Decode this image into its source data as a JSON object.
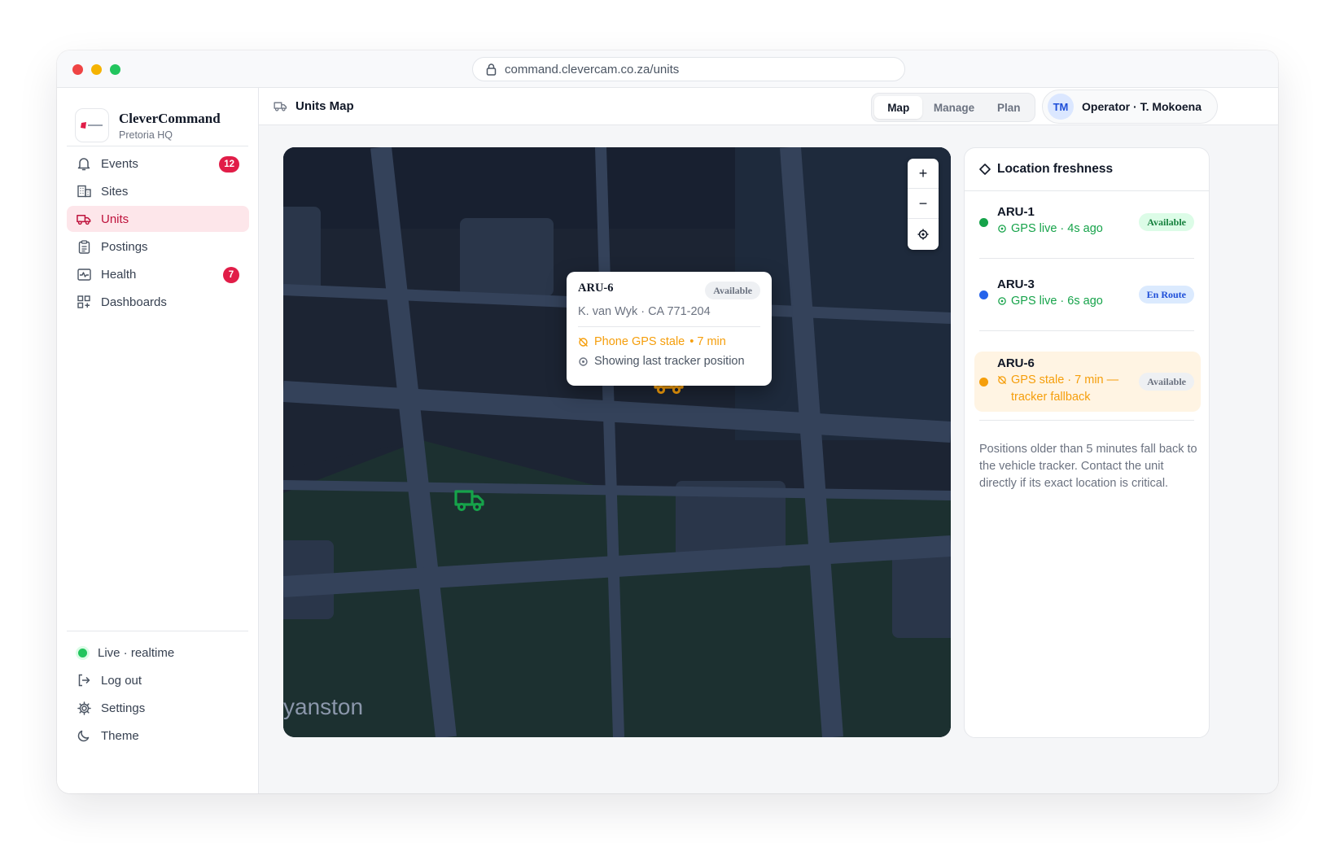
{
  "browser": {
    "url": "command.clevercam.co.za/units"
  },
  "brand": {
    "name": "CleverCommand",
    "subtitle": "Pretoria HQ"
  },
  "sidebar": {
    "items": [
      {
        "label": "Events",
        "icon": "bell-icon",
        "badge": "12"
      },
      {
        "label": "Sites",
        "icon": "building-icon"
      },
      {
        "label": "Units",
        "icon": "truck-icon",
        "active": true
      },
      {
        "label": "Postings",
        "icon": "clipboard-icon"
      },
      {
        "label": "Health",
        "icon": "pulse-icon",
        "badge": "7"
      },
      {
        "label": "Dashboards",
        "icon": "grid-icon"
      }
    ],
    "footer": [
      {
        "label": "Live · realtime",
        "icon": "status-dot"
      },
      {
        "label": "Log out",
        "icon": "logout-icon"
      },
      {
        "label": "Settings",
        "icon": "gear-icon"
      },
      {
        "label": "Theme",
        "icon": "moon-icon"
      }
    ]
  },
  "header": {
    "title": "Units Map",
    "tabs": [
      {
        "label": "Map",
        "active": true
      },
      {
        "label": "Manage"
      },
      {
        "label": "Plan"
      }
    ],
    "user": {
      "initials": "TM",
      "name": "Operator · T. Mokoena"
    }
  },
  "map": {
    "zoom_in": "+",
    "zoom_out": "−",
    "place_label": "yanston",
    "popup": {
      "unit": "ARU-6",
      "status": "Available",
      "driver": "K. van Wyk · CA 771-204",
      "warning": "Phone GPS stale",
      "warning_age": "• 7 min",
      "fallback": "Showing last tracker position"
    }
  },
  "panel": {
    "title": "Location freshness",
    "units": [
      {
        "name": "ARU-1",
        "status_text": "GPS live · 4s ago",
        "badge": "Available",
        "dot_color": "#16a34a",
        "text_color": "#16a34a"
      },
      {
        "name": "ARU-3",
        "status_text": "GPS live · 6s ago",
        "badge": "En Route",
        "dot_color": "#2563eb",
        "text_color": "#16a34a"
      },
      {
        "name": "ARU-6",
        "status_text": "GPS stale · 7 min — tracker fallback",
        "badge": "Available",
        "dot_color": "#f59e0b",
        "text_color": "#f59e0b"
      }
    ],
    "note": "Positions older than 5 minutes fall back to the vehicle tracker. Contact the unit directly if its exact location is critical."
  },
  "colors": {
    "accent": "#e11d48",
    "live": "#22c55e",
    "stale": "#f59e0b",
    "map_bg": "#1c2433"
  }
}
